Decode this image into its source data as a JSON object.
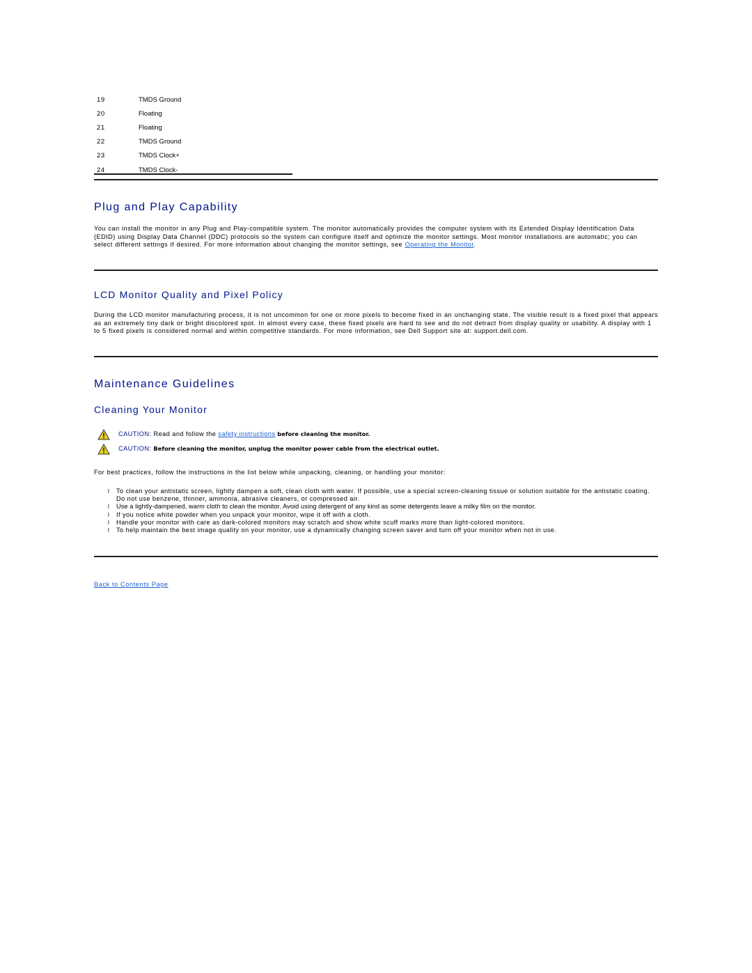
{
  "pin_table": {
    "rows": [
      {
        "pin": "19",
        "signal": "TMDS Ground"
      },
      {
        "pin": "20",
        "signal": "Floating"
      },
      {
        "pin": "21",
        "signal": "Floating"
      },
      {
        "pin": "22",
        "signal": "TMDS Ground"
      },
      {
        "pin": "23",
        "signal": "TMDS Clock+"
      },
      {
        "pin": "24",
        "signal": "TMDS Clock-"
      }
    ]
  },
  "plug_and_play": {
    "title": "Plug and Play Capability",
    "body": "You can install the monitor in any Plug and Play-compatible system. The monitor automatically provides the computer system with its Extended Display Identification Data (EDID) using Display Data Channel (DDC) protocols so the system can configure itself and optimize the monitor settings. Most monitor installations are automatic; you can select different settings if desired. For more information about changing the monitor settings, see ",
    "link": "Operating the Monitor",
    "tail": "."
  },
  "pixel_policy": {
    "title": "LCD Monitor Quality and Pixel Policy",
    "body": "During the LCD monitor manufacturing process, it is not uncommon for one or more pixels to become fixed in an unchanging state. The visible result is a fixed pixel that appears as an extremely tiny dark or bright discolored spot. In almost every case, these fixed pixels are hard to see and do not detract from display quality or usability. A display with 1 to 5 fixed pixels is considered normal and within competitive standards. For more information, see Dell Support site at: support.dell.com."
  },
  "maintenance": {
    "title": "Maintenance Guidelines",
    "subtitle": "Cleaning Your Monitor",
    "cautions": [
      {
        "label": "CAUTION:",
        "text_before": " Read and follow the ",
        "link": "safety instructions",
        "bold": " before cleaning the monitor."
      },
      {
        "label": "CAUTION:",
        "bold": " Before cleaning the monitor, unplug the monitor power cable from the electrical outlet."
      }
    ],
    "intro": "For best practices, follow the instructions in the list below while unpacking, cleaning, or handling your monitor:",
    "bullet_glyph": "l",
    "bullets": [
      "To clean your antistatic screen, lightly dampen a soft, clean cloth with water. If possible, use a special screen-cleaning tissue or solution suitable for the antistatic coating. Do not use benzene, thinner, ammonia, abrasive cleaners, or compressed air.",
      "Use a lightly-dampened, warm cloth to clean the monitor. Avoid using detergent of any kind as some detergents leave a milky film on the monitor.",
      "If you notice white powder when you unpack your monitor, wipe it off with a cloth.",
      "Handle your monitor with care as dark-colored monitors may scratch and show white scuff marks more than light-colored monitors.",
      "To help maintain the best image quality on your monitor, use a dynamically changing screen saver and turn off your monitor when not in use."
    ]
  },
  "footer": {
    "back_link": "Back to Contents Page"
  },
  "colors": {
    "heading": "#00158a",
    "link": "#1b5fcf",
    "rule": "#1e1e1e",
    "warning_fill": "#e8d21a"
  }
}
